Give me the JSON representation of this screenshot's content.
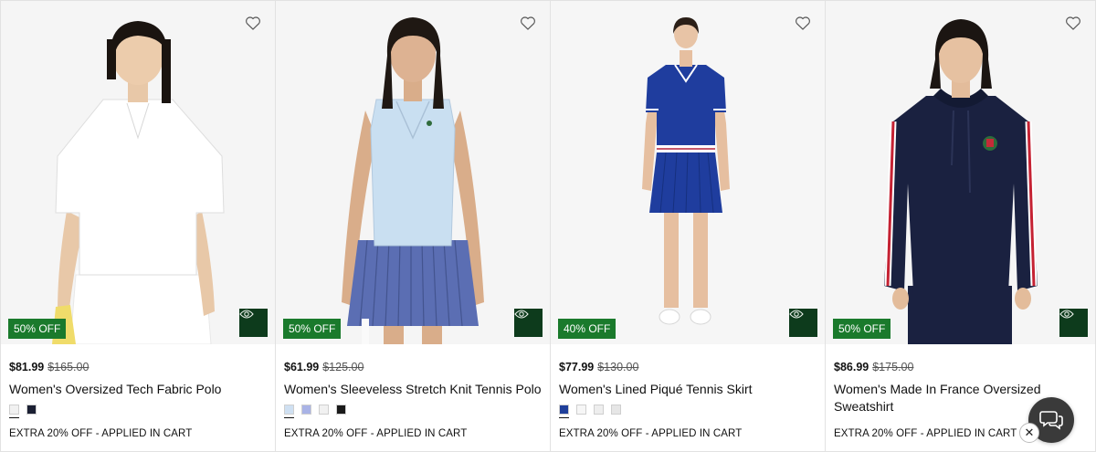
{
  "products": [
    {
      "discount": "50% OFF",
      "price_now": "$81.99",
      "price_was": "$165.00",
      "name": "Women's Oversized Tech Fabric Polo",
      "swatches": [
        "#f1f1f1",
        "#1b2033"
      ],
      "promo": "EXTRA 20% OFF - APPLIED IN CART",
      "garment": "white-polo"
    },
    {
      "discount": "50% OFF",
      "price_now": "$61.99",
      "price_was": "$125.00",
      "name": "Women's Sleeveless Stretch Knit Tennis Polo",
      "swatches": [
        "#cfe0f2",
        "#a9b3e6",
        "#f1f1f1",
        "#1a1a1a"
      ],
      "promo": "EXTRA 20% OFF - APPLIED IN CART",
      "garment": "lightblue-top-pleated-skirt"
    },
    {
      "discount": "40% OFF",
      "price_now": "$77.99",
      "price_was": "$130.00",
      "name": "Women's Lined Piqué Tennis Skirt",
      "swatches": [
        "#1f3f9a",
        "#f6f6f6",
        "#eeeeee",
        "#e6e6e6"
      ],
      "promo": "EXTRA 20% OFF - APPLIED IN CART",
      "garment": "navy-tennis-dress"
    },
    {
      "discount": "50% OFF",
      "price_now": "$86.99",
      "price_was": "$175.00",
      "name": "Women's Made In France Oversized Sweatshirt",
      "swatches": [],
      "promo": "EXTRA 20% OFF - APPLIED IN CART",
      "garment": "navy-hoodie"
    }
  ],
  "icons": {
    "wishlist": "heart-outline-icon",
    "quick_view": "eye-icon",
    "chat": "chat-bubbles-icon",
    "chat_close": "close-icon"
  },
  "colors": {
    "badge_green": "#1a7a2c",
    "quick_view_green": "#0d3b1c"
  },
  "chat_close_glyph": "✕"
}
